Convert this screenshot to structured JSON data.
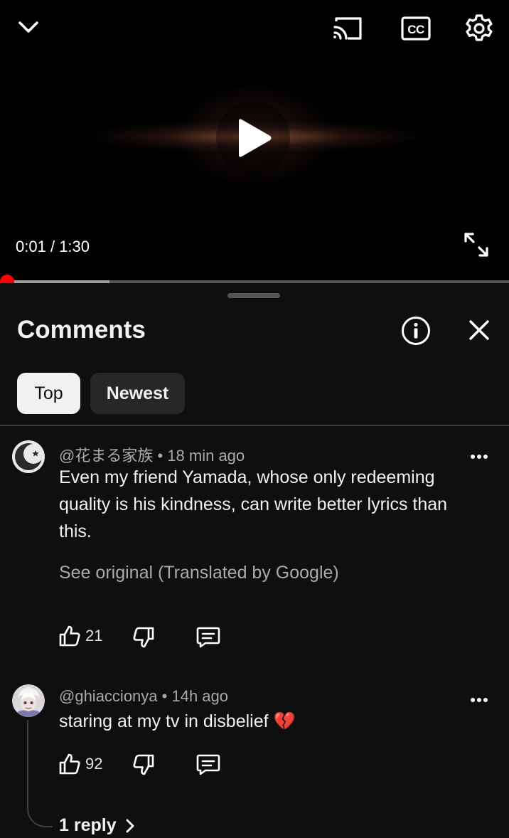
{
  "player": {
    "time_current": "0:01",
    "time_total": "1:30",
    "played_fraction": 0.011,
    "buffered_fraction": 0.215,
    "icons": [
      "chevron-down-icon",
      "cast-icon",
      "cc-icon",
      "gear-icon",
      "play-icon",
      "fullscreen-icon"
    ]
  },
  "comments_panel": {
    "title": "Comments",
    "filters": [
      {
        "label": "Top",
        "selected": true
      },
      {
        "label": "Newest",
        "selected": false
      }
    ],
    "comments": [
      {
        "author": "@花まる家族",
        "time": "18 min ago",
        "text": "Even my friend Yamada, whose only redeeming quality is his kindness, can write better lyrics than this.",
        "translation_note": "See original (Translated by Google)",
        "likes": "21"
      },
      {
        "author": "@ghiaccionya",
        "time": "14h ago",
        "text": "staring at my tv in disbelief 💔",
        "likes": "92",
        "replies_label": "1 reply"
      }
    ]
  },
  "colors": {
    "accent": "#ff0000",
    "background": "#0f0f0f",
    "chip_selected": "#f1f1f1",
    "chip_unselected": "#272727",
    "secondary_text": "#aaaaaa"
  }
}
